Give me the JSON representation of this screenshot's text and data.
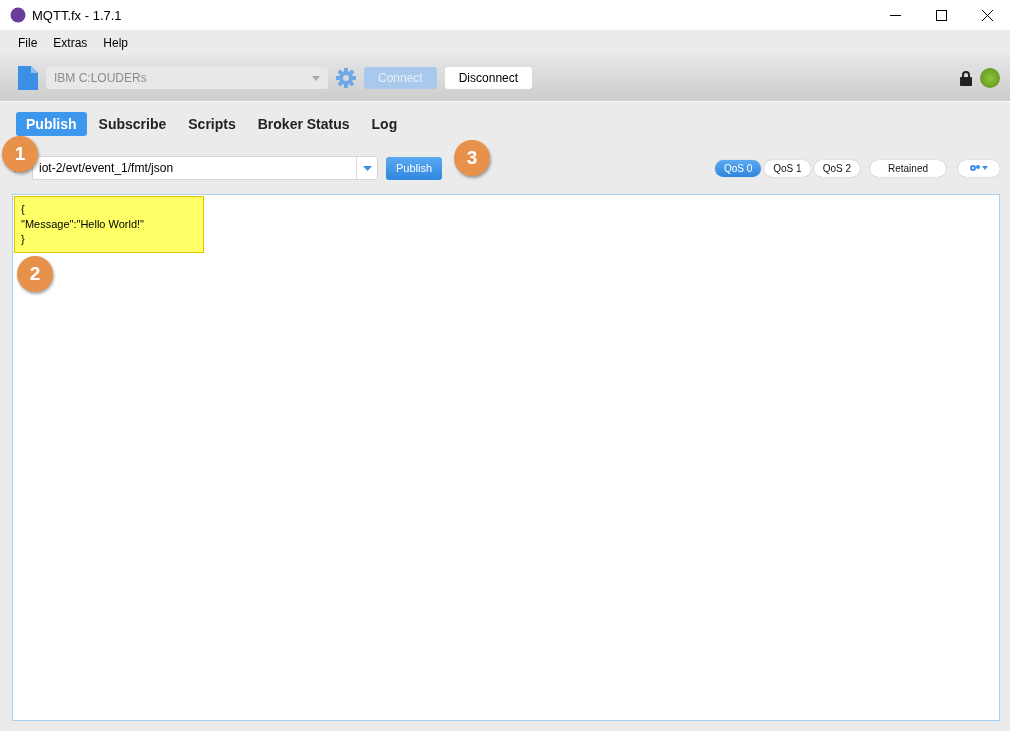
{
  "window": {
    "title": "MQTT.fx - 1.7.1"
  },
  "menu": [
    "File",
    "Extras",
    "Help"
  ],
  "toolbar": {
    "profile": {
      "value": "IBM C:LOUDERs",
      "disabled": true
    },
    "buttons": [
      {
        "label": "Connect",
        "disabled": true
      },
      {
        "label": "Disconnect",
        "disabled": false
      }
    ],
    "connected": true
  },
  "tabs": [
    {
      "label": "Publish",
      "selected": true
    },
    {
      "label": "Subscribe",
      "selected": false
    },
    {
      "label": "Scripts",
      "selected": false
    },
    {
      "label": "Broker Status",
      "selected": false
    },
    {
      "label": "Log",
      "selected": false
    }
  ],
  "publish": {
    "topic": "iot-2/evt/event_1/fmt/json",
    "button": "Publish",
    "qos": [
      {
        "label": "QoS 0",
        "selected": true
      },
      {
        "label": "QoS 1",
        "selected": false
      },
      {
        "label": "QoS 2",
        "selected": false
      }
    ],
    "retained": {
      "label": "Retained",
      "on": false
    }
  },
  "payload": {
    "lines": [
      "{",
      "\"Message\":\"Hello World!\"",
      "}"
    ],
    "highlighted": true
  },
  "annotations": [
    {
      "label": "1"
    },
    {
      "label": "2"
    },
    {
      "label": "3"
    }
  ]
}
